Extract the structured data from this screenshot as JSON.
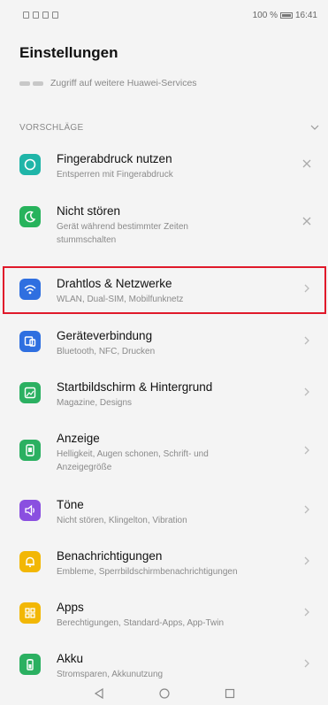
{
  "status_bar": {
    "right_text": "100 % ",
    "time": "16:41"
  },
  "header": {
    "title": "Einstellungen",
    "account_text": "Zugriff auf weitere Huawei-Services"
  },
  "suggestions": {
    "label": "VORSCHLÄGE",
    "items": [
      {
        "title": "Fingerabdruck nutzen",
        "subtitle": "Entsperren mit Fingerabdruck",
        "icon": "fingerprint-icon",
        "color": "#1fb5a8"
      },
      {
        "title": "Nicht stören",
        "subtitle": "Gerät während bestimmter Zeiten",
        "subtitle2": "stummschalten",
        "icon": "moon-icon",
        "color": "#27b35c"
      }
    ]
  },
  "settings": {
    "items": [
      {
        "title": "Drahtlos & Netzwerke",
        "subtitle": "WLAN, Dual-SIM, Mobilfunknetz",
        "icon": "wifi-icon",
        "color": "#2f6fe0"
      },
      {
        "title": "Geräteverbindung",
        "subtitle": "Bluetooth, NFC, Drucken",
        "icon": "device-connection-icon",
        "color": "#2f6fe0"
      },
      {
        "title": "Startbildschirm & Hintergrund",
        "subtitle": "Magazine, Designs",
        "icon": "wallpaper-icon",
        "color": "#2bb061"
      },
      {
        "title": "Anzeige",
        "subtitle": "Helligkeit, Augen schonen, Schrift- und",
        "subtitle2": "Anzeigegröße",
        "icon": "display-icon",
        "color": "#2bb061"
      },
      {
        "title": "Töne",
        "subtitle": "Nicht stören, Klingelton, Vibration",
        "icon": "speaker-icon",
        "color": "#8a4fe0"
      },
      {
        "title": "Benachrichtigungen",
        "subtitle": "Embleme, Sperrbildschirmbenachrichtigungen",
        "icon": "bell-icon",
        "color": "#f2b705"
      },
      {
        "title": "Apps",
        "subtitle": "Berechtigungen, Standard-Apps, App-Twin",
        "icon": "apps-icon",
        "color": "#f2b705"
      },
      {
        "title": "Akku",
        "subtitle": "Stromsparen, Akkunutzung",
        "icon": "battery-icon",
        "color": "#2bb061"
      }
    ]
  }
}
